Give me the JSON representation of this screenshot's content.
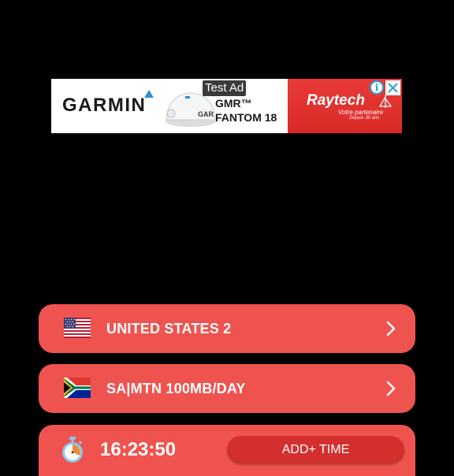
{
  "ad": {
    "test_label": "Test Ad",
    "garmin_brand": "GARMIN",
    "radome_label": "GAR",
    "product_line1": "GMR™",
    "product_line2": "FANTOM 18",
    "raytech_brand": "Raytech",
    "raytech_tagline": "Votre partenaire",
    "raytech_since": "Depuis 30 ans",
    "info_icon": "info-icon",
    "close_icon": "close-icon"
  },
  "server": {
    "label": "UNITED STATES 2",
    "flag": "us-flag-icon"
  },
  "protocol": {
    "label": "SA|MTN 100MB/DAY",
    "flag": "za-flag-icon"
  },
  "timer": {
    "value": "16:23:50",
    "add_button_label": "ADD+ TIME",
    "icon": "stopwatch-icon"
  },
  "colors": {
    "background": "#000000",
    "row": "#ef5350",
    "button": "#d32f2f",
    "text": "#ffffff"
  }
}
